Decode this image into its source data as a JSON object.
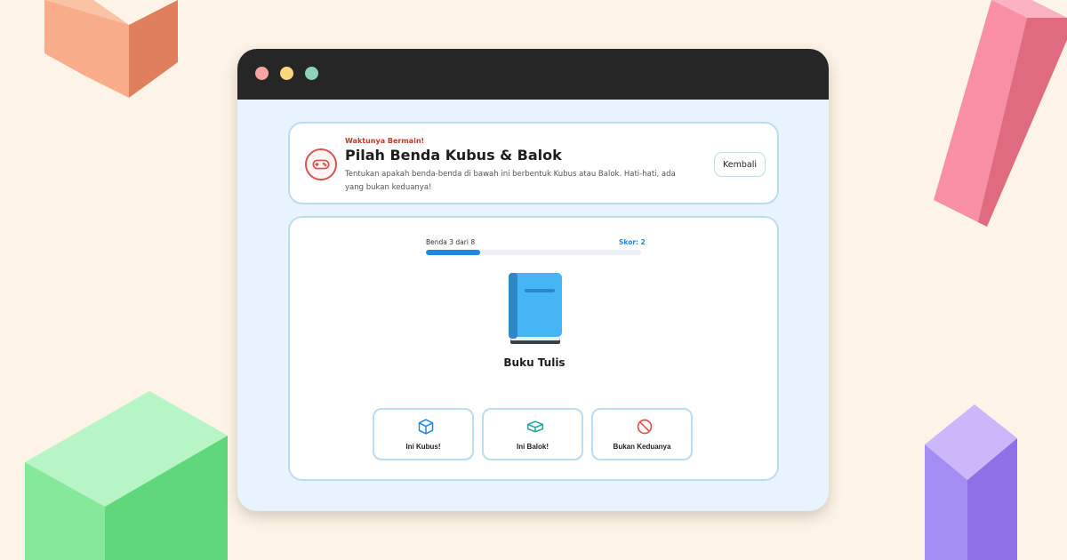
{
  "header": {
    "kicker": "Waktunya Bermain!",
    "title": "Pilah Benda Kubus & Balok",
    "description": "Tentukan apakah benda-benda di bawah ini berbentuk Kubus atau Balok. Hati-hati, ada yang bukan keduanya!",
    "back_label": "Kembali",
    "icon": "gamepad-icon"
  },
  "game": {
    "progress_label": "Benda 3 dari 8",
    "score_label": "Skor: 2",
    "progress_fraction": 0.25,
    "object_name": "Buku Tulis",
    "object_icon": "book-icon",
    "choices": [
      {
        "label": "Ini Kubus!",
        "icon": "cube-icon",
        "color": "#1e88e5"
      },
      {
        "label": "Ini Balok!",
        "icon": "cuboid-icon",
        "color": "#26a69a"
      },
      {
        "label": "Bukan Keduanya",
        "icon": "prohibited-icon",
        "color": "#d9534f"
      }
    ]
  },
  "colors": {
    "accent": "#1e88e5",
    "danger": "#d9534f",
    "background": "#fdf3e6",
    "window_bg": "#e8f3fd",
    "titlebar": "#262626"
  }
}
